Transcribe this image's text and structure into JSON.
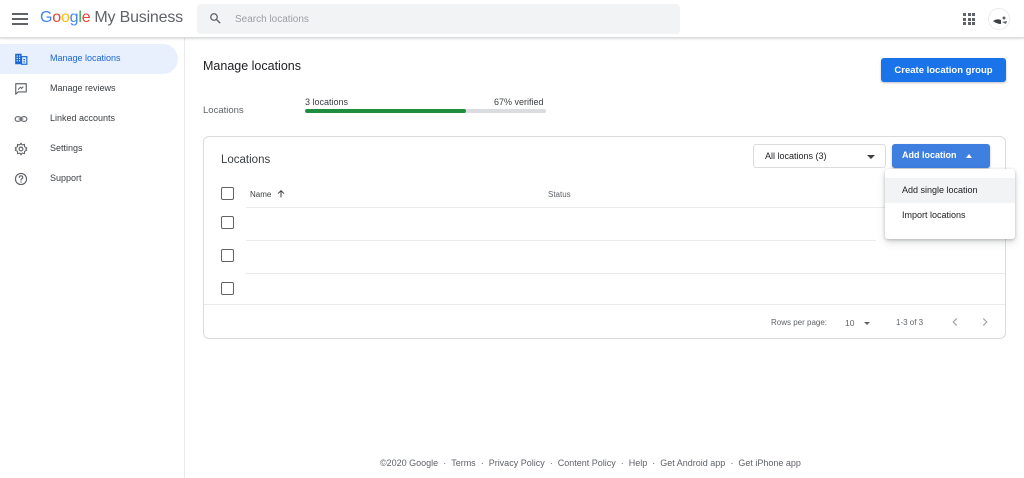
{
  "app": {
    "brand_letters": [
      "G",
      "o",
      "o",
      "g",
      "l",
      "e"
    ],
    "brand_rest": "My Business",
    "search_placeholder": "Search locations"
  },
  "sidebar": {
    "items": [
      {
        "label": "Manage locations",
        "icon": "building-icon",
        "active": true
      },
      {
        "label": "Manage reviews",
        "icon": "review-icon",
        "active": false
      },
      {
        "label": "Linked accounts",
        "icon": "link-icon",
        "active": false
      },
      {
        "label": "Settings",
        "icon": "gear-icon",
        "active": false
      },
      {
        "label": "Support",
        "icon": "help-icon",
        "active": false
      }
    ]
  },
  "main": {
    "title": "Manage locations",
    "create_button": "Create location group",
    "summary": {
      "label": "Locations",
      "count_text": "3 locations",
      "verified_text": "67% verified",
      "verified_fraction": 0.67
    },
    "card": {
      "title": "Locations",
      "filter_value": "All locations (3)",
      "add_button": "Add location",
      "columns": {
        "name": "Name",
        "status": "Status"
      },
      "row_count": 3,
      "pagination": {
        "rows_per_page_label": "Rows per page:",
        "rows_per_page_value": "10",
        "range": "1-3 of 3"
      }
    },
    "add_menu": {
      "items": [
        "Add single location",
        "Import locations"
      ]
    }
  },
  "footer": {
    "copyright": "©2020 Google",
    "separator": "·",
    "links": [
      "Terms",
      "Privacy Policy",
      "Content Policy",
      "Help",
      "Get Android app",
      "Get iPhone app"
    ]
  },
  "colors": {
    "accent": "#1a73e8",
    "progress": "#1e8e3e",
    "active_nav_bg": "#e8f0fe"
  }
}
